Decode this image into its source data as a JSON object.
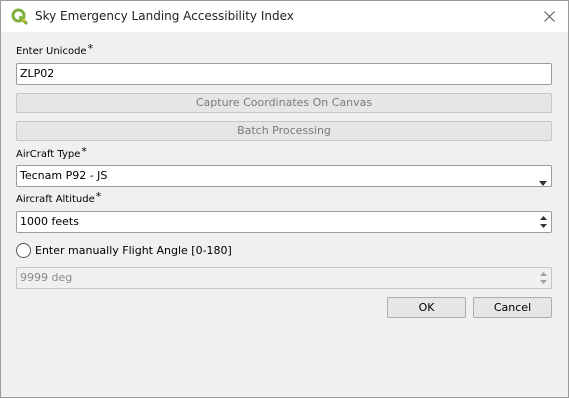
{
  "window": {
    "title": "Sky Emergency Landing Accessibility Index",
    "app_icon": "qgis-icon",
    "close_icon": "close-icon"
  },
  "form": {
    "unicode_label": "Enter Unicode",
    "unicode_value": "ZLP02",
    "capture_button": "Capture Coordinates On Canvas",
    "batch_button": "Batch Processing",
    "aircraft_type_label": "AirCraft Type",
    "aircraft_type_value": "Tecnam P92 - JS",
    "altitude_label": "Aircraft Altitude",
    "altitude_value": "1000 feets",
    "manual_angle_label": "Enter manually Flight Angle [0-180]",
    "manual_angle_checked": false,
    "angle_value": "9999  deg",
    "required_marker": "*"
  },
  "buttons": {
    "ok": "OK",
    "cancel": "Cancel"
  },
  "colors": {
    "qgis_green": "#7fb03f",
    "window_bg": "#f0f0f0"
  }
}
